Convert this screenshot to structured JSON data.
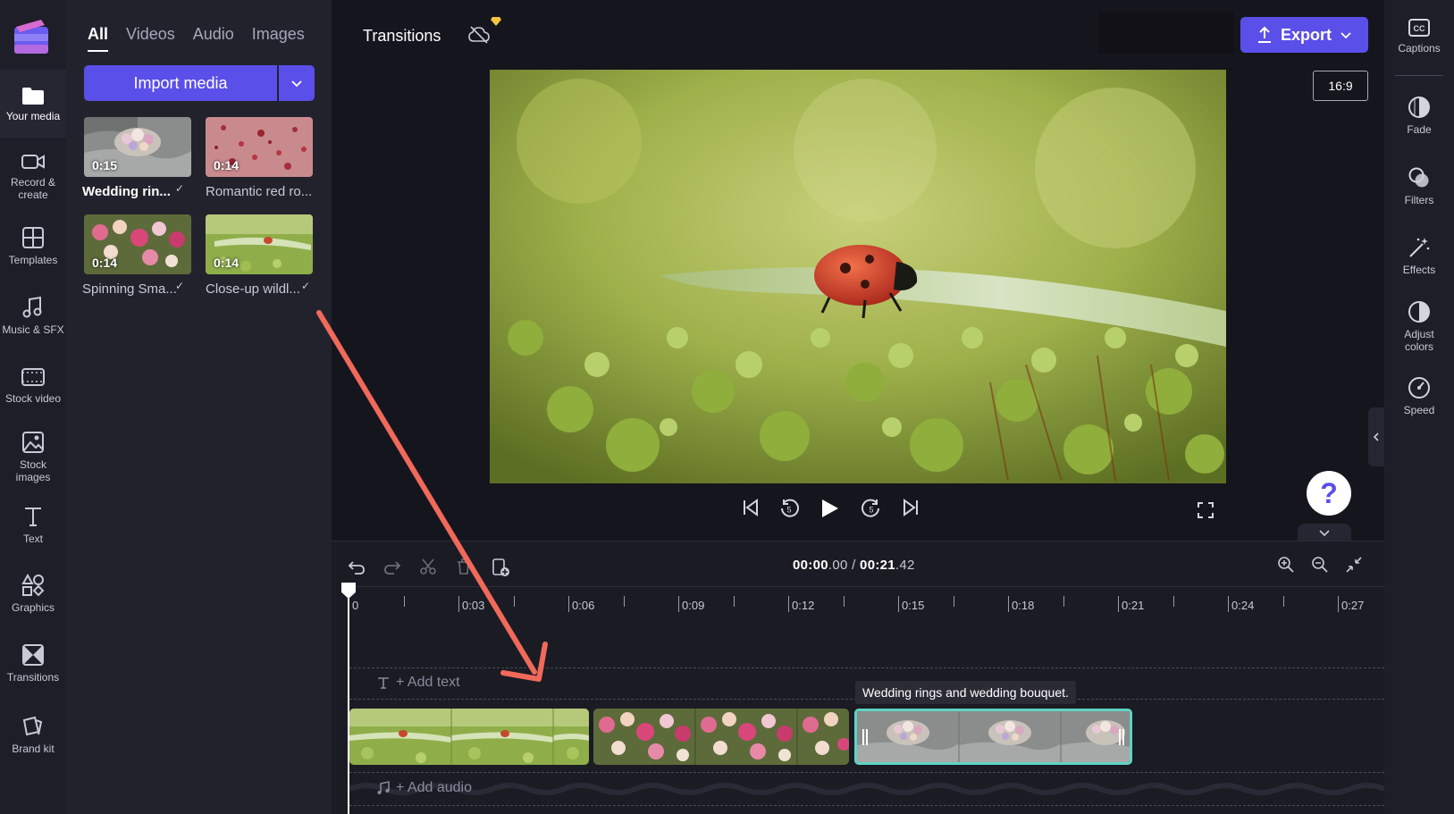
{
  "left_nav": {
    "items": [
      {
        "label": "Your media",
        "icon": "folder-icon"
      },
      {
        "label": "Record &\ncreate",
        "icon": "camera-icon"
      },
      {
        "label": "Templates",
        "icon": "templates-icon"
      },
      {
        "label": "Music & SFX",
        "icon": "music-note-icon"
      },
      {
        "label": "Stock video",
        "icon": "film-icon"
      },
      {
        "label": "Stock\nimages",
        "icon": "image-icon"
      },
      {
        "label": "Text",
        "icon": "text-icon"
      },
      {
        "label": "Graphics",
        "icon": "shapes-icon"
      },
      {
        "label": "Transitions",
        "icon": "transition-icon"
      },
      {
        "label": "Brand kit",
        "icon": "brand-kit-icon"
      }
    ]
  },
  "media_panel": {
    "tabs": [
      "All",
      "Videos",
      "Audio",
      "Images"
    ],
    "active_tab": "All",
    "import_label": "Import media",
    "items": [
      {
        "duration": "0:15",
        "name": "Wedding rin...",
        "selected": true,
        "checked": true
      },
      {
        "duration": "0:14",
        "name": "Romantic red ro...",
        "selected": false,
        "checked": false
      },
      {
        "duration": "0:14",
        "name": "Spinning Sma...",
        "selected": false,
        "checked": true
      },
      {
        "duration": "0:14",
        "name": "Close-up wildl...",
        "selected": false,
        "checked": true
      }
    ]
  },
  "header": {
    "breadcrumb": "Transitions",
    "export_label": "Export"
  },
  "preview": {
    "aspect_ratio": "16:9"
  },
  "timeline": {
    "current_time": "00:00",
    "current_frac": ".00",
    "separator": "/",
    "total_time": "00:21",
    "total_frac": ".42",
    "ruler_labels": [
      "0",
      "0:03",
      "0:06",
      "0:09",
      "0:12",
      "0:15",
      "0:18",
      "0:21",
      "0:24",
      "0:27"
    ],
    "add_text_label": "+ Add text",
    "add_audio_label": "+ Add audio",
    "tooltip": "Wedding rings and wedding bouquet."
  },
  "right_panel": {
    "items": [
      {
        "label": "Captions",
        "icon": "captions-icon"
      },
      {
        "label": "Fade",
        "icon": "fade-icon"
      },
      {
        "label": "Filters",
        "icon": "filters-icon"
      },
      {
        "label": "Effects",
        "icon": "magic-wand-icon"
      },
      {
        "label": "Adjust\ncolors",
        "icon": "adjust-colors-icon"
      },
      {
        "label": "Speed",
        "icon": "speedometer-icon"
      }
    ]
  },
  "colors": {
    "accent": "#5b4fe9",
    "selected_clip_border": "#5fd4c4",
    "annotation_arrow": "#f0695a"
  }
}
